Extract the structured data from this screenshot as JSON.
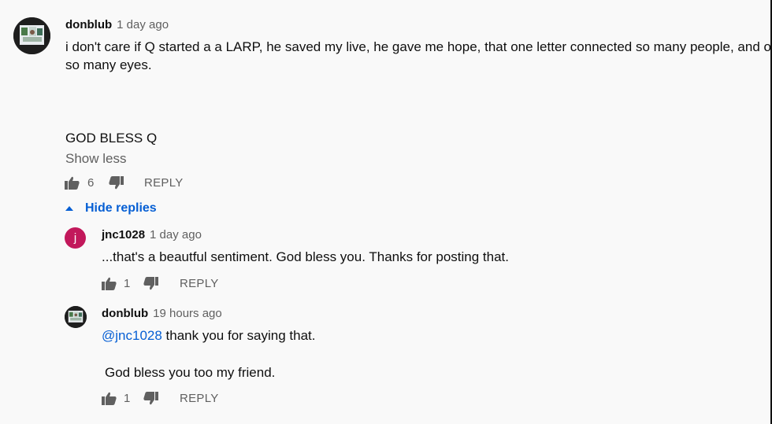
{
  "comment": {
    "author": "donblub",
    "time": "1 day ago",
    "line1": "i don't care if Q started a a LARP, he saved my live, he gave me hope, that one letter connected so many people, and opend",
    "line2": "so many eyes.",
    "line3": "GOD BLESS Q",
    "show_less": "Show less",
    "likes": "6",
    "reply_label": "REPLY"
  },
  "hide_replies_label": "Hide replies",
  "replies": [
    {
      "author": "jnc1028",
      "avatar_letter": "j",
      "time": "1 day ago",
      "text": "...that's a beautful sentiment. God bless you. Thanks for posting that.",
      "likes": "1",
      "reply_label": "REPLY"
    },
    {
      "author": "donblub",
      "time": "19 hours ago",
      "mention": "@jnc1028",
      "text": " thank you for saying that.",
      "text2": "God bless you too my friend.",
      "likes": "1",
      "reply_label": "REPLY"
    }
  ],
  "colors": {
    "link": "#065fd4",
    "muted": "#606060",
    "avatar_j": "#c2185b",
    "background": "#f9f9f9"
  },
  "icons": [
    "thumb-up-icon",
    "thumb-down-icon",
    "caret-up-icon"
  ]
}
